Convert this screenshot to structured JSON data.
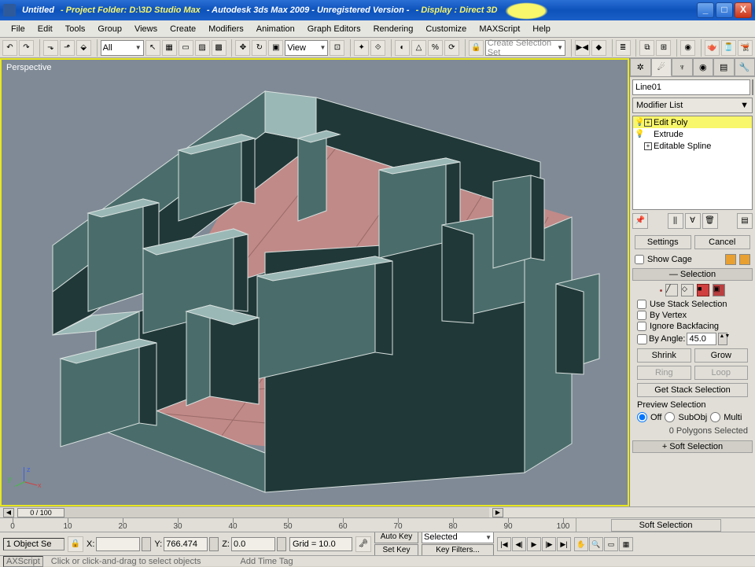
{
  "title": {
    "untitled": "Untitled",
    "project": "- Project Folder: D:\\3D Studio Max",
    "app": "- Autodesk 3ds Max 2009 - Unregistered Version -",
    "display": "- Display : Direct 3D"
  },
  "menu": [
    "File",
    "Edit",
    "Tools",
    "Group",
    "Views",
    "Create",
    "Modifiers",
    "Animation",
    "Graph Editors",
    "Rendering",
    "Customize",
    "MAXScript",
    "Help"
  ],
  "toolbar1": {
    "filter_sel": "All",
    "refcoord": "View",
    "selset_placeholder": "Create Selection Set"
  },
  "viewport_label": "Perspective",
  "axis": {
    "x": "x",
    "y": "y",
    "z": "z"
  },
  "cmdpanel": {
    "object_name": "Line01",
    "mod_list_label": "Modifier List",
    "stack": [
      {
        "label": "Edit Poly",
        "sel": true,
        "exp": "+",
        "bulb": "💡"
      },
      {
        "label": "Extrude",
        "sel": false,
        "exp": "",
        "bulb": "💡"
      },
      {
        "label": "Editable Spline",
        "sel": false,
        "exp": "+",
        "bulb": ""
      }
    ],
    "settings": "Settings",
    "cancel": "Cancel",
    "showcage": "Show Cage",
    "selection_head": "Selection",
    "use_stack": "Use Stack Selection",
    "by_vertex": "By Vertex",
    "ignore_bf": "Ignore Backfacing",
    "by_angle": "By Angle:",
    "angle_val": "45.0",
    "shrink": "Shrink",
    "grow": "Grow",
    "ring": "Ring",
    "loop": "Loop",
    "get_stack": "Get Stack Selection",
    "preview": "Preview Selection",
    "off": "Off",
    "subobj": "SubObj",
    "multi": "Multi",
    "polysel": "0 Polygons Selected",
    "soft_sel": "Soft Selection"
  },
  "timeline": {
    "pos": "0 / 100",
    "ticks": [
      0,
      10,
      20,
      30,
      40,
      50,
      60,
      70,
      80,
      90,
      100
    ],
    "coords": {
      "xlabel": "X:",
      "x": "",
      "ylabel": "Y:",
      "y": "766.474",
      "zlabel": "Z:",
      "z": "0.0"
    },
    "grid": "Grid = 10.0",
    "autokey": "Auto Key",
    "setkey": "Set Key",
    "key_sel": "Selected",
    "keyfilters": "Key Filters...",
    "addtime": "Add Time Tag",
    "status1": "1 Object Se",
    "status_hint": "Click or click-and-drag to select objects",
    "maxscript": "AXScript"
  }
}
